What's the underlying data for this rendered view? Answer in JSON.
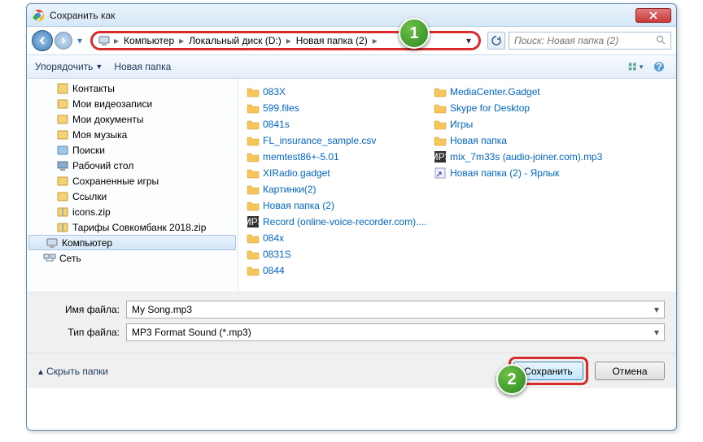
{
  "window": {
    "title": "Сохранить как"
  },
  "callouts": {
    "one": "1",
    "two": "2"
  },
  "breadcrumb": {
    "items": [
      "Компьютер",
      "Локальный диск (D:)",
      "Новая папка (2)"
    ]
  },
  "search": {
    "placeholder": "Поиск: Новая папка (2)"
  },
  "toolbar": {
    "organize": "Упорядочить",
    "newfolder": "Новая папка"
  },
  "sidebar": {
    "items": [
      {
        "label": "Контакты",
        "icon": "contacts"
      },
      {
        "label": "Мои видеозаписи",
        "icon": "video"
      },
      {
        "label": "Мои документы",
        "icon": "docs"
      },
      {
        "label": "Моя музыка",
        "icon": "music"
      },
      {
        "label": "Поиски",
        "icon": "search"
      },
      {
        "label": "Рабочий стол",
        "icon": "desktop"
      },
      {
        "label": "Сохраненные игры",
        "icon": "games"
      },
      {
        "label": "Ссылки",
        "icon": "links"
      },
      {
        "label": "icons.zip",
        "icon": "zip"
      },
      {
        "label": "Тарифы Совкомбанк 2018.zip",
        "icon": "zip"
      }
    ],
    "root": [
      {
        "label": "Компьютер",
        "icon": "computer",
        "selected": true
      },
      {
        "label": "Сеть",
        "icon": "network"
      }
    ]
  },
  "files": {
    "col1": [
      {
        "label": "083X",
        "icon": "folder"
      },
      {
        "label": "599.files",
        "icon": "folder"
      },
      {
        "label": "0841s",
        "icon": "folder"
      },
      {
        "label": "FL_insurance_sample.csv",
        "icon": "folder"
      },
      {
        "label": "memtest86+-5.01",
        "icon": "folder"
      },
      {
        "label": "XIRadio.gadget",
        "icon": "folder"
      },
      {
        "label": "Картинки(2)",
        "icon": "folder"
      },
      {
        "label": "Новая папка (2)",
        "icon": "folder"
      },
      {
        "label": "Record (online-voice-recorder.com)....",
        "icon": "mp3"
      }
    ],
    "col2": [
      {
        "label": "084x",
        "icon": "folder"
      },
      {
        "label": "0831S",
        "icon": "folder"
      },
      {
        "label": "0844",
        "icon": "folder"
      },
      {
        "label": "MediaCenter.Gadget",
        "icon": "folder"
      },
      {
        "label": "Skype for Desktop",
        "icon": "folder"
      },
      {
        "label": "Игры",
        "icon": "folder"
      },
      {
        "label": "Новая папка",
        "icon": "folder"
      },
      {
        "label": "mix_7m33s (audio-joiner.com).mp3",
        "icon": "mp3"
      },
      {
        "label": "Новая папка (2) - Ярлык",
        "icon": "shortcut"
      }
    ]
  },
  "fields": {
    "filename_label": "Имя файла:",
    "filename_value": "My Song.mp3",
    "filetype_label": "Тип файла:",
    "filetype_value": "MP3 Format Sound (*.mp3)"
  },
  "footer": {
    "hide": "Скрыть папки",
    "save": "Сохранить",
    "cancel": "Отмена"
  }
}
